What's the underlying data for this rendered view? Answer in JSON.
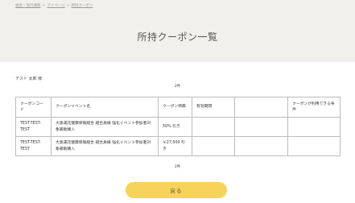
{
  "breadcrumb": [
    {
      "label": "福島・旅行通販"
    },
    {
      "label": "マイページ"
    },
    {
      "label": "所持クーポン"
    }
  ],
  "breadcrumb_separator": ">",
  "page_title": "所持クーポン一覧",
  "user_name": "テスト 太郎 様",
  "count_label": "2件",
  "table": {
    "headers": [
      "クーポンコード",
      "クーポンイベント名",
      "クーポン特典",
      "有効期間",
      "",
      "クーポンが利用できる条件"
    ],
    "rows": [
      [
        "TEST-TEST-TEST",
        "大黒運託健康保険組合 組合員様 強化イベント参加者対象補助購入",
        "50% 引き",
        "",
        "",
        ""
      ],
      [
        "TEST-TEST-TEST",
        "大黒運託健康保険組合 組合員様 強化イベント参加者対象補助購入",
        "￥27,500 引き",
        "",
        "",
        ""
      ]
    ]
  },
  "back_button": "戻る"
}
